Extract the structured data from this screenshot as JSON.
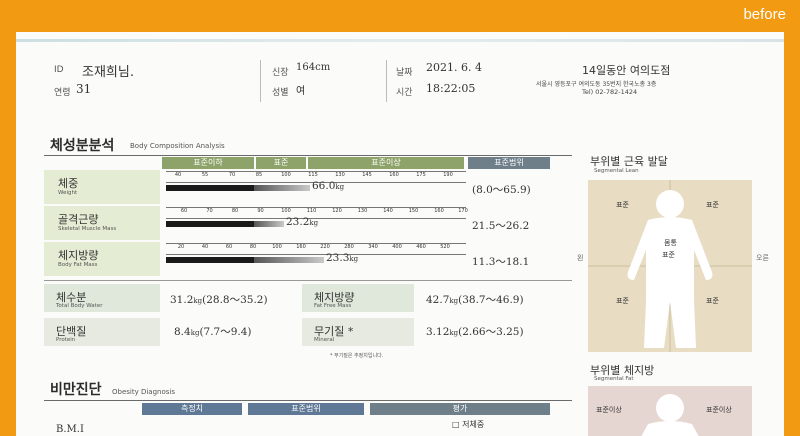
{
  "badge": "before",
  "header": {
    "id_label": "ID",
    "id_value": "조재희님.",
    "age_label": "연령",
    "age_value": "31",
    "height_label": "신장",
    "height_value": "164cm",
    "sex_label": "성별",
    "sex_value": "여",
    "date_label": "날짜",
    "date_value": "2021. 6. 4",
    "time_label": "시간",
    "time_value": "18:22:05",
    "clinic_name": "14일동안 여의도점",
    "clinic_address": "서울시 영등포구 여의도동 35번지 한국노총 3층",
    "clinic_tel": "Tel) 02-782-1424"
  },
  "body_comp": {
    "title": "체성분분석",
    "subtitle": "Body Composition Analysis",
    "header_below": "표준이하",
    "header_std": "표준",
    "header_above": "표준이상",
    "header_range": "표준범위",
    "rows": [
      {
        "label": "체중",
        "eng": "Weight",
        "ticks": [
          "40",
          "55",
          "70",
          "85",
          "100",
          "115",
          "130",
          "145",
          "160",
          "175",
          "190",
          "205"
        ],
        "value": "66.0",
        "unit": "kg",
        "range": "(8.0～65.9)",
        "level": 0.48
      },
      {
        "label": "골격근량",
        "eng": "Skeletal Muscle Mass",
        "ticks": [
          "60",
          "70",
          "80",
          "90",
          "100",
          "110",
          "120",
          "130",
          "140",
          "150",
          "160",
          "170"
        ],
        "value": "23.2",
        "unit": "kg",
        "range": "21.5～26.2",
        "level": 0.5
      },
      {
        "label": "체지방량",
        "eng": "Body Fat Mass",
        "ticks": [
          "20",
          "40",
          "60",
          "80",
          "100",
          "160",
          "220",
          "280",
          "340",
          "400",
          "460",
          "520"
        ],
        "value": "23.3",
        "unit": "kg",
        "range": "11.3～18.1",
        "level": 0.56
      }
    ]
  },
  "boxes": [
    {
      "label": "체수분",
      "eng": "Total Body Water",
      "value": "31.2",
      "unit": "kg",
      "range": "(28.8～35.2)"
    },
    {
      "label": "체지방량",
      "eng": "Fat Free Mass",
      "value": "42.7",
      "unit": "kg",
      "range": "(38.7～46.9)"
    },
    {
      "label": "단백질",
      "eng": "Protein",
      "value": "8.4",
      "unit": "kg",
      "range": "(7.7～9.4)"
    },
    {
      "label": "무기질",
      "eng": "Mineral",
      "value": "3.12",
      "unit": "kg",
      "range": "(2.66～3.25)"
    }
  ],
  "mineral_star": "*",
  "mineral_note": "* 무기질은 추정치입니다.",
  "segmental_lean": {
    "title": "부위별 근육 발달",
    "subtitle": "Segmental Lean",
    "left_arm": "표준",
    "right_arm": "표준",
    "trunk_top": "몸통",
    "trunk": "표준",
    "left_leg": "표준",
    "right_leg": "표준",
    "side_left": "왼",
    "side_right": "오른"
  },
  "segmental_fat": {
    "title": "부위별 체지방",
    "subtitle": "Segmental Fat",
    "left_arm": "표준이상",
    "right_arm": "표준이상"
  },
  "obesity": {
    "title": "비만진단",
    "subtitle": "Obesity Diagnosis",
    "col_measured": "측정치",
    "col_range": "표준범위",
    "col_eval": "평가",
    "check_label": "□ 저체중",
    "bmi_label": "B.M.I"
  },
  "colors": {
    "frame": "#f29a12",
    "green_header": "#8ea36a",
    "grey_header": "#6e7f8a",
    "blue_header": "#5f7896",
    "silhouette_bg": "#e8dcc3"
  }
}
